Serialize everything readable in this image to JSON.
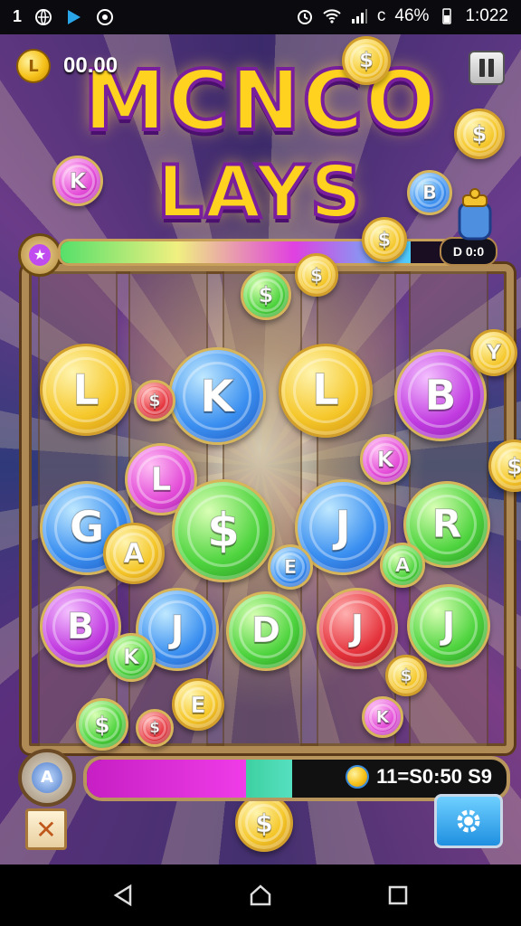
{
  "status_bar": {
    "left_icons": [
      "signal-number-icon",
      "globe-icon",
      "play-icon",
      "location-icon"
    ],
    "left_text": "1",
    "battery": "46%",
    "battery_prefix": "c",
    "time": "1:022"
  },
  "game": {
    "balance": "00.00",
    "balance_coin_letter": "L",
    "title_line1": "MCNCO",
    "title_line2": "LAYS",
    "top_progress": {
      "label": "D 0:0",
      "fill_fraction": 0.88
    },
    "bottom_progress": {
      "score": "11=S0:50 S9",
      "magenta_fraction": 0.38,
      "teal_fraction": 0.11
    },
    "gear_badge_letter": "A",
    "close_label": "✕",
    "grid_coins": [
      {
        "letter": "L",
        "color": "gold"
      },
      {
        "letter": "K",
        "color": "blue"
      },
      {
        "letter": "L",
        "color": "gold"
      },
      {
        "letter": "B",
        "color": "purple"
      },
      {
        "letter": "L",
        "color": "pink"
      },
      {
        "letter": "G",
        "color": "blue"
      },
      {
        "letter": "A",
        "color": "gold"
      },
      {
        "letter": "$",
        "color": "green"
      },
      {
        "letter": "J",
        "color": "blue"
      },
      {
        "letter": "R",
        "color": "green"
      },
      {
        "letter": "B",
        "color": "purple"
      },
      {
        "letter": "J",
        "color": "blue"
      },
      {
        "letter": "D",
        "color": "green"
      },
      {
        "letter": "J",
        "color": "red"
      },
      {
        "letter": "J",
        "color": "green"
      }
    ],
    "flying_coins": [
      {
        "letter": "$",
        "color": "gold"
      },
      {
        "letter": "$",
        "color": "gold"
      },
      {
        "letter": "K",
        "color": "pink"
      },
      {
        "letter": "B",
        "color": "blue"
      },
      {
        "letter": "$",
        "color": "gold"
      },
      {
        "letter": "$",
        "color": "green"
      },
      {
        "letter": "$",
        "color": "gold"
      },
      {
        "letter": "Y",
        "color": "gold"
      },
      {
        "letter": "$",
        "color": "red"
      },
      {
        "letter": "K",
        "color": "pink"
      },
      {
        "letter": "E",
        "color": "blue"
      },
      {
        "letter": "$",
        "color": "gold"
      },
      {
        "letter": "A",
        "color": "green"
      },
      {
        "letter": "K",
        "color": "green"
      },
      {
        "letter": "E",
        "color": "gold"
      },
      {
        "letter": "$",
        "color": "green"
      },
      {
        "letter": "K",
        "color": "pink"
      },
      {
        "letter": "$",
        "color": "gold"
      },
      {
        "letter": "$",
        "color": "red"
      },
      {
        "letter": "$",
        "color": "gold"
      }
    ]
  },
  "nav_bar": {
    "icons": [
      "back-icon",
      "home-icon",
      "recents-icon"
    ]
  }
}
